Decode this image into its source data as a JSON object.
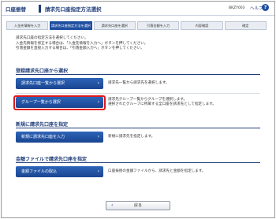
{
  "header": {
    "tag": "口座振替",
    "title": "請求先口座指定方法選択",
    "screen_code": "BKZY003",
    "help_label": "ヘルプ",
    "help_icon": "?"
  },
  "steps": [
    {
      "label": "入金先情報を入力",
      "active": false
    },
    {
      "label": "請求先口座指定方法を選択",
      "active": true
    },
    {
      "label": "請求先口座を選択",
      "active": false
    },
    {
      "label": "引落金額を入力",
      "active": false
    },
    {
      "label": "内容確認",
      "active": false
    },
    {
      "label": "確定",
      "active": false
    }
  ],
  "description": [
    "請求先口座の指定方法を選択してください。",
    "入金先情報を修正する場合は、「入金先情報を入力へ」ボタンを押してください。",
    "引落金額を直接入力する場合は、「引落金額入力へ」ボタンを押してください。"
  ],
  "sections": {
    "registered": {
      "title": "登録請求先口座から選択",
      "btn1_label": "請求先口座一覧から選択",
      "btn1_desc": "請求先一覧から請求先を選択します。",
      "btn2_label": "グループ一覧から選択",
      "btn2_desc_1": "請求先グループ一覧からグループを選択します。",
      "btn2_desc_2": "選択されたグループに所属する全口座を請求先として指定します。"
    },
    "new": {
      "title": "新規に請求先口座を指定",
      "btn_label": "新規に請求先口座を入力",
      "btn_desc": "新規に請求先を指定します。"
    },
    "file": {
      "title": "金額ファイルで請求先口座を指定",
      "btn_label": "金額ファイルの取込",
      "btn_desc": "口座振替の金額ファイルから、請求先と金額を指定します。"
    }
  },
  "back_label": "戻る",
  "colors": {
    "accent": "#1f4fa1",
    "highlight": "#e0191c"
  }
}
